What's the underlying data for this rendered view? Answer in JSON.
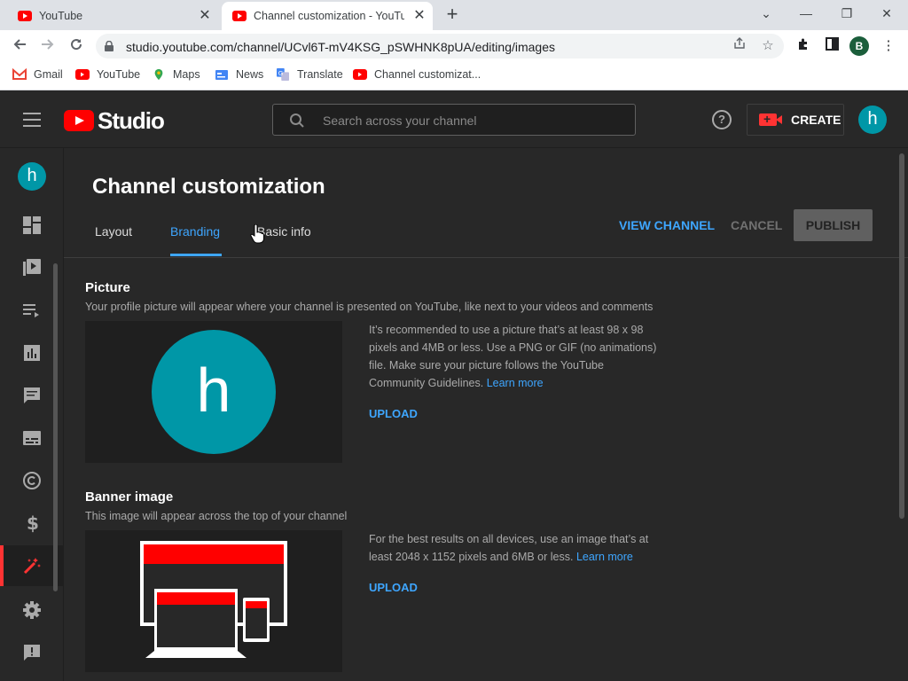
{
  "browser": {
    "tabs": [
      {
        "title": "YouTube",
        "close": "✕"
      },
      {
        "title": "Channel customization - YouTube Studio",
        "close": "✕"
      }
    ],
    "new_tab": "+",
    "window_controls": {
      "tab_search": "⌄",
      "minimize": "—",
      "restore": "❐",
      "close": "✕"
    },
    "url": "studio.youtube.com/channel/UCvl6T-mV4KSG_pSWHNK8pUA/editing/images",
    "profile_initial": "B",
    "bookmarks": [
      "Gmail",
      "YouTube",
      "Maps",
      "News",
      "Translate",
      "Channel customizat..."
    ]
  },
  "studio": {
    "logo_text": "Studio",
    "search_placeholder": "Search across your channel",
    "help": "?",
    "create_label": "CREATE",
    "avatar_initial": "h"
  },
  "sidebar": {
    "avatar_initial": "h",
    "items": [
      "dashboard",
      "content",
      "playlists",
      "analytics",
      "comments",
      "subtitles",
      "copyright",
      "earn",
      "customization",
      "settings",
      "feedback"
    ],
    "active": "customization"
  },
  "page": {
    "title": "Channel customization",
    "tabs": [
      "Layout",
      "Branding",
      "Basic info"
    ],
    "active_tab": "Branding",
    "view_channel": "VIEW CHANNEL",
    "cancel": "CANCEL",
    "publish": "PUBLISH"
  },
  "picture": {
    "title": "Picture",
    "description": "Your profile picture will appear where your channel is presented on YouTube, like next to your videos and comments",
    "avatar_initial": "h",
    "info": "It’s recommended to use a picture that’s at least 98 x 98 pixels and 4MB or less. Use a PNG or GIF (no animations) file. Make sure your picture follows the YouTube Community Guidelines.",
    "learn_more": "Learn more",
    "upload": "UPLOAD"
  },
  "banner": {
    "title": "Banner image",
    "description": "This image will appear across the top of your channel",
    "info": "For the best results on all devices, use an image that’s at least 2048 x 1152 pixels and 6MB or less.",
    "learn_more": "Learn more",
    "upload": "UPLOAD"
  },
  "colors": {
    "brand_red": "#ff0000",
    "accent_blue": "#3ea6ff",
    "avatar_teal": "#0097a7"
  }
}
